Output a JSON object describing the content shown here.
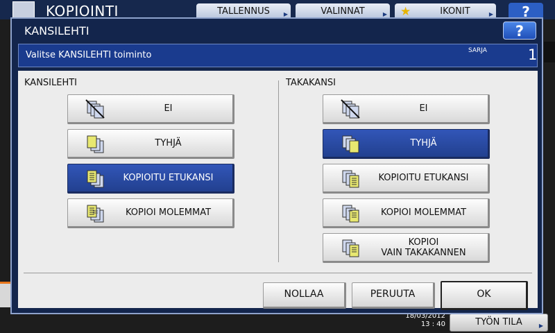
{
  "background_app": {
    "title": "KOPIOINTI",
    "tabs": [
      "TALLENNUS",
      "VALINNAT",
      "IKONIT"
    ],
    "help": "?",
    "date": "18/03/2012",
    "time": "13 : 40",
    "status_button": "TYÖN TILA"
  },
  "dialog": {
    "title": "KANSILEHTI",
    "help": "?",
    "message": "Valitse KANSILEHTI toiminto",
    "sets_label": "SARJA",
    "sets_value": "1",
    "front": {
      "label": "KANSILEHTI",
      "options": [
        "EI",
        "TYHJÄ",
        "KOPIOITU ETUKANSI",
        "KOPIOI MOLEMMAT"
      ],
      "selected": "KOPIOITU ETUKANSI"
    },
    "back": {
      "label": "TAKAKANSI",
      "options": [
        "EI",
        "TYHJÄ",
        "KOPIOITU ETUKANSI",
        "KOPIOI MOLEMMAT",
        "KOPIOI\nVAIN TAKAKANNEN"
      ],
      "selected": "TYHJÄ"
    },
    "actions": {
      "reset": "NOLLAA",
      "cancel": "PERUUTA",
      "ok": "OK"
    }
  },
  "colors": {
    "selected_button": "#2a4ba6",
    "header_bar": "#1a3b8e",
    "dialog_frame": "#13254c",
    "page_yellow": "#e8e870",
    "page_blue": "#cfd8ee"
  }
}
